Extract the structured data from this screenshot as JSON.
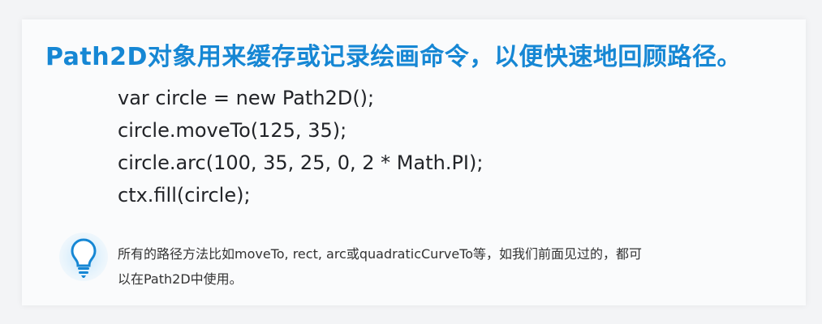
{
  "colors": {
    "accent": "#1687d4",
    "code_text": "#222428",
    "body_text": "#333333",
    "card_background": "#fafbfc",
    "page_background": "#f3f4f6"
  },
  "heading": "Path2D对象用来缓存或记录绘画命令，以便快速地回顾路径。",
  "code_lines": [
    "var circle = new Path2D();",
    "circle.moveTo(125, 35);",
    "circle.arc(100, 35, 25, 0, 2 * Math.PI);",
    "ctx.fill(circle);"
  ],
  "tip": {
    "icon": "lightbulb-icon",
    "lines": [
      "所有的路径方法比如moveTo, rect, arc或quadraticCurveTo等，如我们前面见过的，都可",
      "以在Path2D中使用。"
    ]
  }
}
